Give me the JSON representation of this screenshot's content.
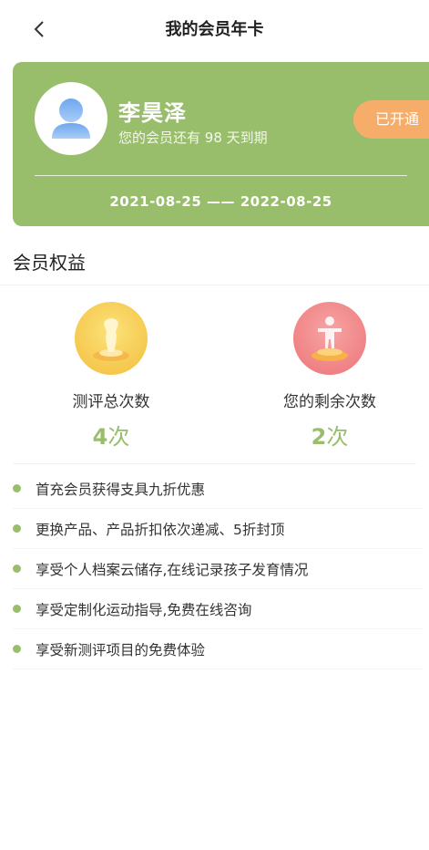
{
  "header": {
    "title": "我的会员年卡"
  },
  "card": {
    "user_name": "李昊泽",
    "expire_prefix": "您的会员还有",
    "days_left": "98",
    "expire_suffix": "天到期",
    "status": "已开通",
    "date_range": "2021-08-25 —— 2022-08-25"
  },
  "benefits_section": {
    "title": "会员权益"
  },
  "stats": [
    {
      "label": "测评总次数",
      "value": "4",
      "unit": "次"
    },
    {
      "label": "您的剩余次数",
      "value": "2",
      "unit": "次"
    }
  ],
  "benefits": [
    "首充会员获得支具九折优惠",
    "更换产品、产品折扣依次递减、5折封顶",
    "享受个人档案云储存,在线记录孩子发育情况",
    "享受定制化运动指导,免费在线咨询",
    "享受新测评项目的免费体验"
  ],
  "colors": {
    "brand_green": "#98bd6b",
    "badge_orange": "#f6ad6a"
  }
}
